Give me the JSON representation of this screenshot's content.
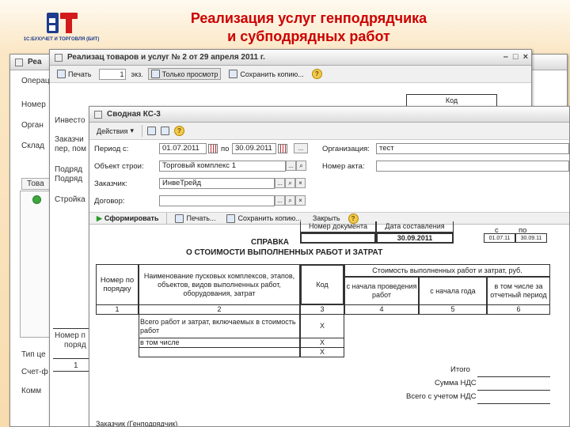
{
  "slide": {
    "title_line1": "Реализация услуг генподрядчика",
    "title_line2": "и субподрядных работ",
    "logo_caption": "1С:БУХУЧЕТ И ТОРГОВЛЯ (БИТ)"
  },
  "back_window": {
    "title": "Реа",
    "labels": [
      "Операц",
      "Номер",
      "Орган",
      "Склад",
      "Това",
      "№",
      "1",
      "Тип це",
      "Счет-ф",
      "Комм"
    ]
  },
  "mid_window": {
    "title": "Реализац товаров и услуг № 2 от 29 апреля 2011 г.",
    "toolbar": {
      "print": "Печать",
      "copies": "1",
      "copies_unit": "экз.",
      "view_only": "Только просмотр",
      "save_copy": "Сохранить копию..."
    },
    "kod_header": "Код",
    "labels": [
      "Инвесто",
      "Заказчи",
      "пер, пом",
      "Подряд",
      "Подряд",
      "Стройка",
      "Номер п",
      "поряд",
      "1"
    ]
  },
  "front_window": {
    "title": "Сводная КС-3",
    "actions_menu": "Действия",
    "form": {
      "period_from_label": "Период с:",
      "period_from": "01.07.2011",
      "period_to_label": "по",
      "period_to": "30.09.2011",
      "organization_label": "Организация:",
      "organization": "тест",
      "object_label": "Объект строи:",
      "object": "Торговый комплекс 1",
      "act_number_label": "Номер акта:",
      "act_number": "",
      "customer_label": "Заказчик:",
      "customer": "ИнвеТрейд",
      "contract_label": "Договор:",
      "contract": ""
    },
    "toolbar": {
      "generate": "Сформировать",
      "print": "Печать...",
      "save_copy": "Сохранить копию...",
      "close": "Закрыть"
    }
  },
  "report": {
    "doc_number_header": "Номер документа",
    "doc_date_header": "Дата составления",
    "doc_date": "30.09.2011",
    "period_from_header": "с",
    "period_to_header": "по",
    "period_from": "01.07.11",
    "period_to": "30.09.11",
    "title1": "СПРАВКА",
    "title2": "О СТОИМОСТИ ВЫПОЛНЕННЫХ РАБОТ И ЗАТРАТ",
    "col_order": "Номер по порядку",
    "col_name": "Наименование пусковых комплексов, этапов, объектов, видов выполненных работ, оборудования, затрат",
    "col_code": "Код",
    "col_cost": "Стоимость выполненных работ и затрат, руб.",
    "col_since_start": "с начала проведения работ",
    "col_since_year": "с начала года",
    "col_period": "в том числе за отчетный период",
    "num1": "1",
    "num2": "2",
    "num3": "3",
    "num4": "4",
    "num5": "5",
    "num6": "6",
    "row_total": "Всего работ и затрат, включаемых в стоимость работ",
    "row_incl": "в том числе",
    "mark_x": "X",
    "itogo": "Итого",
    "vat": "Сумма НДС",
    "total_vat": "Всего с учетом НДС",
    "customer_footer": "Заказчик (Генподрядчик)"
  }
}
